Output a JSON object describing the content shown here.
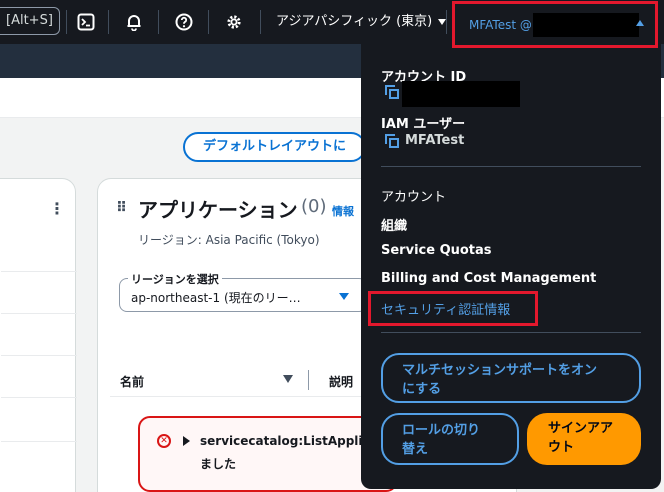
{
  "topnav": {
    "shortcut": "[Alt+S]",
    "region": "アジアパシフィック (東京)",
    "account_name": "MFATest @"
  },
  "actions": {
    "default_layout": "デフォルトレイアウトに"
  },
  "app_widget": {
    "title": "アプリケーション",
    "count": "(0)",
    "info": "情報",
    "region_line": "リージョン: Asia Pacific (Tokyo)",
    "select_label": "リージョンを選択",
    "select_value": "ap-northeast-1 (現在のリー…",
    "col_name": "名前",
    "col_desc": "説明",
    "alert_line1": "servicecatalog:ListApplications",
    "alert_line2": "ました"
  },
  "dropdown": {
    "account_id_label": "アカウント ID",
    "iam_user_label": "IAM ユーザー",
    "iam_user_value": "MFATest",
    "items": [
      "アカウント",
      "組織",
      "Service Quotas",
      "Billing and Cost Management"
    ],
    "security_credentials": "セキュリティ認証情報",
    "multi_session_1": "マルチセッションサポートをオン",
    "multi_session_2": "にする",
    "switch_role_1": "ロールの切り",
    "switch_role_2": "替え",
    "sign_out_1": "サインアア",
    "sign_out_2": "ウト"
  },
  "colors": {
    "nav_bg": "#16191f",
    "accent_blue": "#539fe5",
    "link_blue": "#0972d3",
    "signout_orange": "#ff9900",
    "highlight_red": "#e3182d"
  }
}
